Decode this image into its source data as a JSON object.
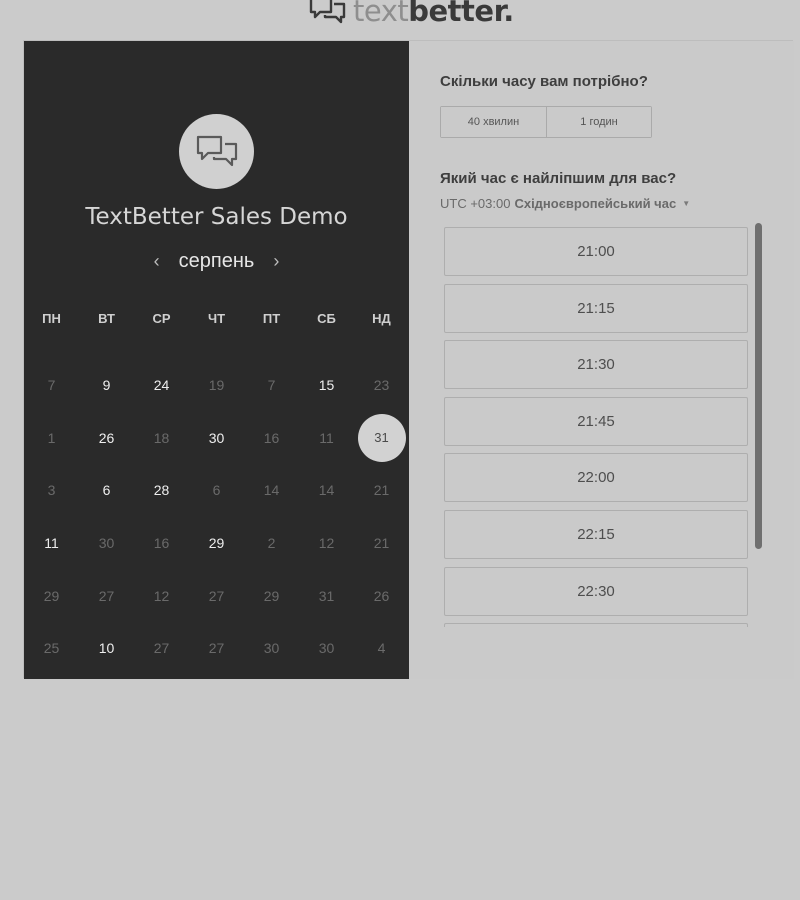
{
  "logo": {
    "text_light": "text",
    "text_bold": "better",
    "text_dot": "."
  },
  "event": {
    "title": "TextBetter Sales Demo"
  },
  "calendar": {
    "prev": "‹",
    "next": "›",
    "month": "серпень",
    "weekdays": [
      "ПН",
      "ВТ",
      "СР",
      "ЧТ",
      "ПТ",
      "СБ",
      "НД"
    ],
    "weeks": [
      [
        {
          "d": "7",
          "s": "muted"
        },
        {
          "d": "9",
          "s": "active"
        },
        {
          "d": "24",
          "s": "active"
        },
        {
          "d": "19",
          "s": "muted"
        },
        {
          "d": "7",
          "s": "muted"
        },
        {
          "d": "15",
          "s": "active"
        },
        {
          "d": "23",
          "s": "muted"
        }
      ],
      [
        {
          "d": "1",
          "s": "muted"
        },
        {
          "d": "26",
          "s": "active"
        },
        {
          "d": "18",
          "s": "muted"
        },
        {
          "d": "30",
          "s": "active"
        },
        {
          "d": "16",
          "s": "muted"
        },
        {
          "d": "11",
          "s": "muted"
        },
        {
          "d": "31",
          "s": "selected"
        }
      ],
      [
        {
          "d": "3",
          "s": "muted"
        },
        {
          "d": "6",
          "s": "active"
        },
        {
          "d": "28",
          "s": "active"
        },
        {
          "d": "6",
          "s": "muted"
        },
        {
          "d": "14",
          "s": "muted"
        },
        {
          "d": "14",
          "s": "muted"
        },
        {
          "d": "21",
          "s": "muted"
        }
      ],
      [
        {
          "d": "11",
          "s": "active"
        },
        {
          "d": "30",
          "s": "muted"
        },
        {
          "d": "16",
          "s": "muted"
        },
        {
          "d": "29",
          "s": "active"
        },
        {
          "d": "2",
          "s": "muted"
        },
        {
          "d": "12",
          "s": "muted"
        },
        {
          "d": "21",
          "s": "muted"
        }
      ],
      [
        {
          "d": "29",
          "s": "muted"
        },
        {
          "d": "27",
          "s": "muted"
        },
        {
          "d": "12",
          "s": "muted"
        },
        {
          "d": "27",
          "s": "muted"
        },
        {
          "d": "29",
          "s": "muted"
        },
        {
          "d": "31",
          "s": "muted"
        },
        {
          "d": "26",
          "s": "muted"
        }
      ],
      [
        {
          "d": "25",
          "s": "muted"
        },
        {
          "d": "10",
          "s": "active"
        },
        {
          "d": "27",
          "s": "muted"
        },
        {
          "d": "27",
          "s": "muted"
        },
        {
          "d": "30",
          "s": "muted"
        },
        {
          "d": "30",
          "s": "muted"
        },
        {
          "d": "4",
          "s": "muted"
        }
      ]
    ]
  },
  "booking": {
    "duration_question": "Скільки часу вам потрібно?",
    "durations": [
      "40 хвилин",
      "1 годин"
    ],
    "time_question": "Який час є найліпшим для вас?",
    "timezone_offset": "UTC +03:00",
    "timezone_name": "Східноєвропейський час",
    "timezone_caret": "▼",
    "slots": [
      "21:00",
      "21:15",
      "21:30",
      "21:45",
      "22:00",
      "22:15",
      "22:30",
      ""
    ]
  },
  "colors": {
    "page_bg": "#cbcbcb",
    "left_panel": "#2a2a2a",
    "right_panel": "#cacaca",
    "selected_day": "#d2d2d2"
  },
  "icons": {
    "logo": "chat-bubbles-icon",
    "avatar": "chat-bubbles-icon"
  }
}
